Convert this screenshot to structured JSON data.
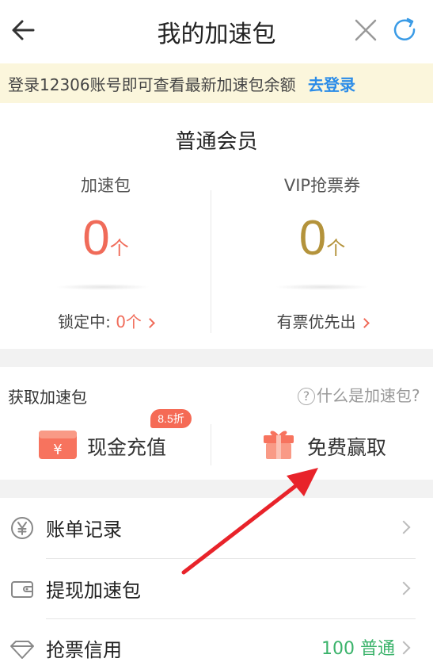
{
  "header": {
    "title": "我的加速包",
    "back_icon": "arrow-left-icon",
    "close_icon": "close-icon",
    "refresh_icon": "refresh-icon"
  },
  "notice": {
    "text": "登录12306账号即可查看最新加速包余额",
    "link": "去登录"
  },
  "member": {
    "level": "普通会员",
    "speed_pack": {
      "label": "加速包",
      "count": "0",
      "unit": "个",
      "footer_label": "锁定中:",
      "footer_value": "0个"
    },
    "vip_coupon": {
      "label": "VIP抢票券",
      "count": "0",
      "unit": "个",
      "footer_label": "有票优先出"
    }
  },
  "get_section": {
    "title": "获取加速包",
    "help": "什么是加速包?",
    "help_icon": "question-icon",
    "cash": {
      "label": "现金充值",
      "badge": "8.5折",
      "icon": "cash-envelope-icon"
    },
    "free": {
      "label": "免费赢取",
      "icon": "gift-icon"
    }
  },
  "list": [
    {
      "label": "账单记录",
      "icon": "yen-coin-icon"
    },
    {
      "label": "提现加速包",
      "icon": "wallet-icon"
    },
    {
      "label": "抢票信用",
      "icon": "diamond-icon",
      "value": "100 普通"
    }
  ],
  "colors": {
    "accent_red": "#f06b59",
    "gold": "#b4933b",
    "link_blue": "#2b8ce8",
    "credit_green": "#3bb36b",
    "notice_bg": "#fbf6dc",
    "annotation_arrow": "#e8232a"
  }
}
